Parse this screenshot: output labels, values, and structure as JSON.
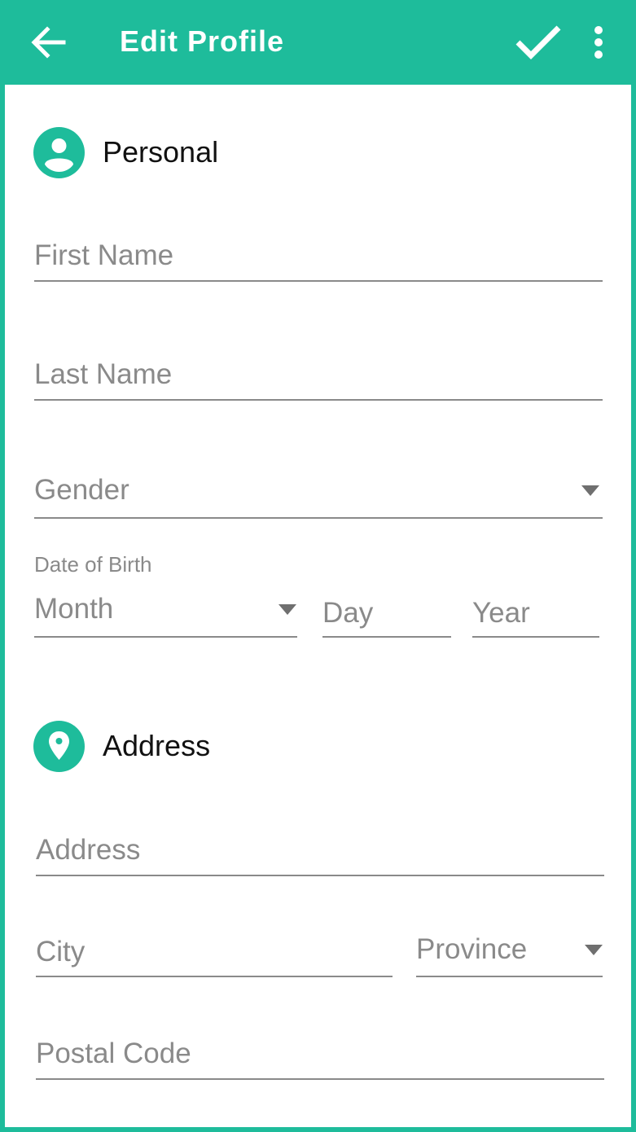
{
  "appbar": {
    "title": "Edit Profile",
    "back_icon": "arrow-left-icon",
    "save_icon": "check-icon",
    "more_icon": "more-vertical-icon",
    "color": "#1ebc9b"
  },
  "personal": {
    "section_title": "Personal",
    "icon": "person-icon",
    "first_name": {
      "placeholder": "First Name",
      "value": ""
    },
    "last_name": {
      "placeholder": "Last Name",
      "value": ""
    },
    "gender": {
      "placeholder": "Gender"
    },
    "dob": {
      "label": "Date of Birth",
      "month": "Month",
      "day": "Day",
      "year": "Year"
    }
  },
  "address": {
    "section_title": "Address",
    "icon": "location-pin-icon",
    "address": {
      "placeholder": "Address",
      "value": ""
    },
    "city": {
      "placeholder": "City",
      "value": ""
    },
    "province": {
      "placeholder": "Province"
    },
    "postal_code": {
      "placeholder": "Postal Code",
      "value": ""
    }
  }
}
